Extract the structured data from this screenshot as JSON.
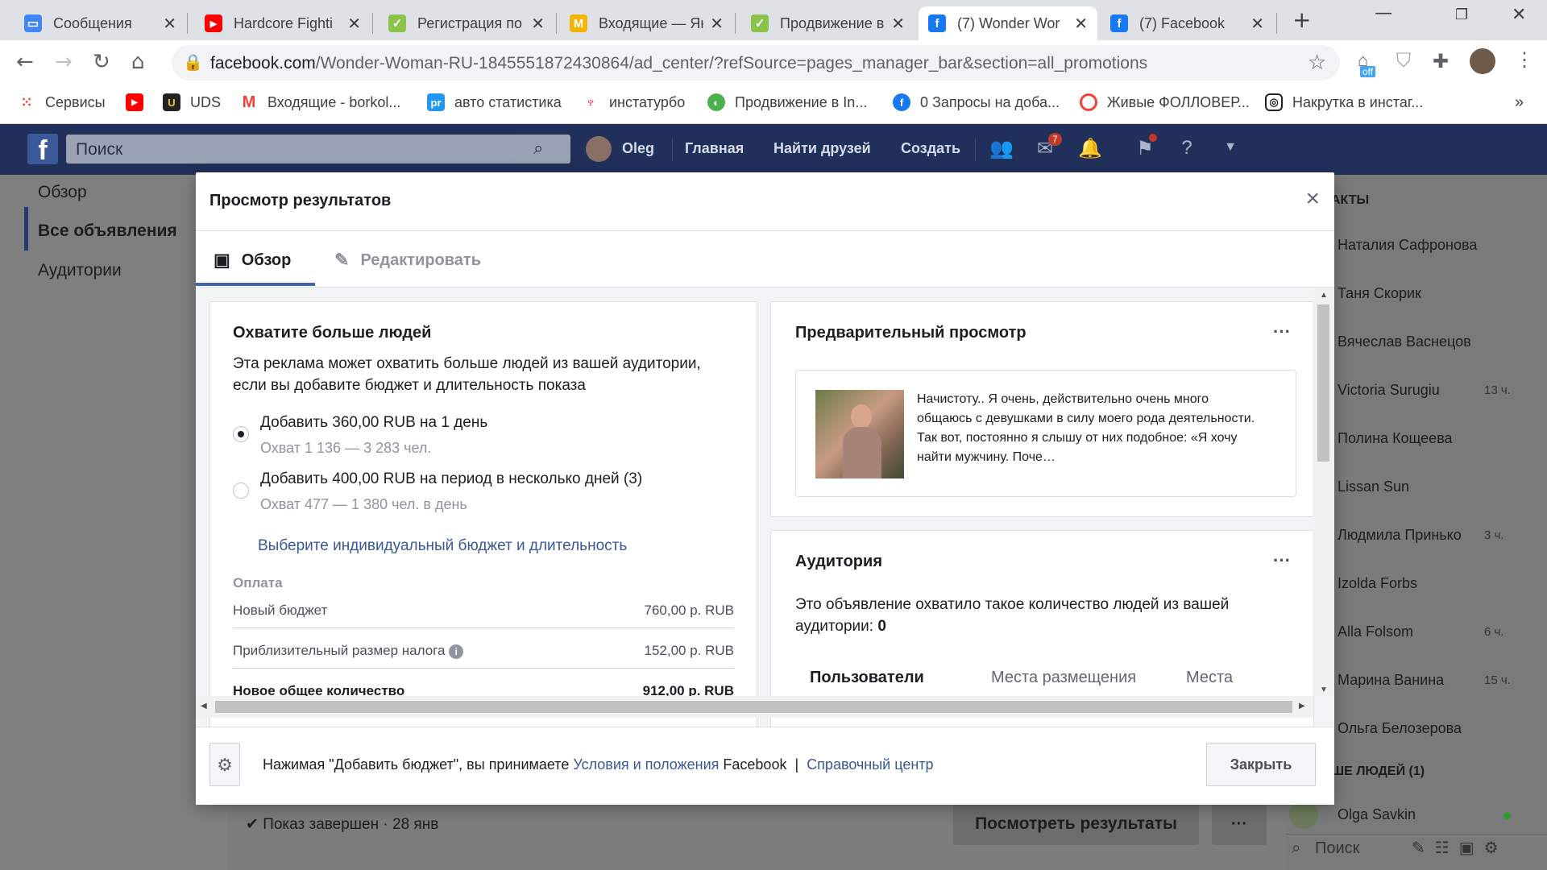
{
  "browser": {
    "tabs": [
      {
        "title": "Сообщения",
        "icon": "messages-icon",
        "color": "#4285f4",
        "active": false
      },
      {
        "title": "Hardcore Fighti",
        "icon": "youtube-icon",
        "color": "#ff0000",
        "active": false
      },
      {
        "title": "Регистрация по",
        "icon": "check-icon",
        "color": "#8bc34a",
        "active": false
      },
      {
        "title": "Входящие — Ян",
        "icon": "gmail-icon",
        "color": "#f4b400",
        "active": false
      },
      {
        "title": "Продвижение в",
        "icon": "check-icon",
        "color": "#8bc34a",
        "active": false
      },
      {
        "title": "(7) Wonder Wor",
        "icon": "facebook-icon",
        "color": "#1877f2",
        "active": true
      },
      {
        "title": "(7) Facebook",
        "icon": "facebook-icon",
        "color": "#1877f2",
        "active": false
      }
    ],
    "new_tab": "+",
    "url_host": "facebook.com",
    "url_path": "/Wonder-Woman-RU-1845551872430864/ad_center/?refSource=pages_manager_bar&section=all_promotions",
    "ext_badge": "off",
    "bookmarks": [
      {
        "label": "Сервисы",
        "icon": "apps-grid-icon",
        "color": "#ea4335"
      },
      {
        "label": "",
        "icon": "youtube-icon",
        "color": "#ff0000"
      },
      {
        "label": "UDS",
        "icon": "uds-icon",
        "color": "#222222"
      },
      {
        "label": "Входящие - borkol...",
        "icon": "gmail-icon",
        "color": "#ea4335"
      },
      {
        "label": "авто статистика",
        "icon": "pr-icon",
        "color": "#2196f3"
      },
      {
        "label": "инстатурбо",
        "icon": "rocket-icon",
        "color": "#e91e63"
      },
      {
        "label": "Продвижение в In...",
        "icon": "green-circle-icon",
        "color": "#4caf50"
      },
      {
        "label": "0 Запросы на доба...",
        "icon": "facebook-icon",
        "color": "#1877f2"
      },
      {
        "label": "Живые ФОЛЛОВЕР...",
        "icon": "red-ring-icon",
        "color": "#f44336"
      },
      {
        "label": "Накрутка в инстаг...",
        "icon": "instagram-icon",
        "color": "#222222"
      }
    ],
    "bookmarks_more": "»"
  },
  "fb": {
    "search_placeholder": "Поиск",
    "user": "Oleg",
    "nav": [
      "Главная",
      "Найти друзей",
      "Создать"
    ],
    "messages_badge": "7"
  },
  "sidebar": {
    "items": [
      "Обзор",
      "Все объявления",
      "Аудитории"
    ]
  },
  "chat": {
    "header": "АКТЫ",
    "contacts": [
      {
        "name": "Наталия Сафронова",
        "time": ""
      },
      {
        "name": "Таня Скорик",
        "time": ""
      },
      {
        "name": "Вячеслав Васнецов",
        "time": ""
      },
      {
        "name": "Victoria Surugiu",
        "time": "13 ч."
      },
      {
        "name": "Полина Кощеева",
        "time": ""
      },
      {
        "name": "Lissan Sun",
        "time": ""
      },
      {
        "name": "Людмила Принько",
        "time": "3 ч."
      },
      {
        "name": "Izolda Forbs",
        "time": ""
      },
      {
        "name": "Alla Folsom",
        "time": "6 ч."
      },
      {
        "name": "Марина Ванина",
        "time": "15 ч."
      },
      {
        "name": "Ольга Белозерова",
        "time": ""
      }
    ],
    "more_people": "ШЕ ЛЮДЕЙ (1)",
    "online_user": "Olga Savkin",
    "search": "Поиск"
  },
  "behind": {
    "status": "Показ завершен",
    "date": "28 янв",
    "view_results": "Посмотреть результаты",
    "more": "···"
  },
  "modal": {
    "title": "Просмотр результатов",
    "tabs": [
      "Обзор",
      "Редактировать"
    ],
    "reach": {
      "title": "Охватите больше людей",
      "desc": "Эта реклама может охватить больше людей из вашей аудитории, если вы добавите бюджет и длительность показа",
      "option1": "Добавить 360,00 RUB на 1 день",
      "option1_reach": "Охват 1 136 — 3 283 чел.",
      "option2": "Добавить 400,00 RUB на период в несколько дней (3)",
      "option2_reach": "Охват 477 — 1 380 чел. в день",
      "custom_link": "Выберите индивидуальный бюджет и длительность",
      "payment_label": "Оплата",
      "rows": [
        {
          "label": "Новый бюджет",
          "value": "760,00 р. RUB"
        },
        {
          "label": "Приблизительный размер налога",
          "value": "152,00 р. RUB"
        },
        {
          "label": "Новое общее количество",
          "value": "912,00 р. RUB"
        }
      ]
    },
    "preview": {
      "title": "Предварительный просмотр",
      "more": "···",
      "text": "Начистоту..    Я очень, действительно очень много общаюсь с девушками в силу моего рода деятельности. Так вот, постоянно я слышу от них подобное:    «Я хочу найти мужчину. Поче…"
    },
    "audience": {
      "title": "Аудитория",
      "more": "···",
      "desc": "Это объявление охватило такое количество людей из вашей аудитории: ",
      "count": "0",
      "tabs": [
        "Пользователи",
        "Места размещения",
        "Места"
      ]
    },
    "footer": {
      "text_pre": "Нажимая \"Добавить бюджет\", вы принимаете ",
      "terms": "Условия и положения",
      "text_mid": " Facebook",
      "sep": "|",
      "help": "Справочный центр",
      "close": "Закрыть"
    }
  }
}
